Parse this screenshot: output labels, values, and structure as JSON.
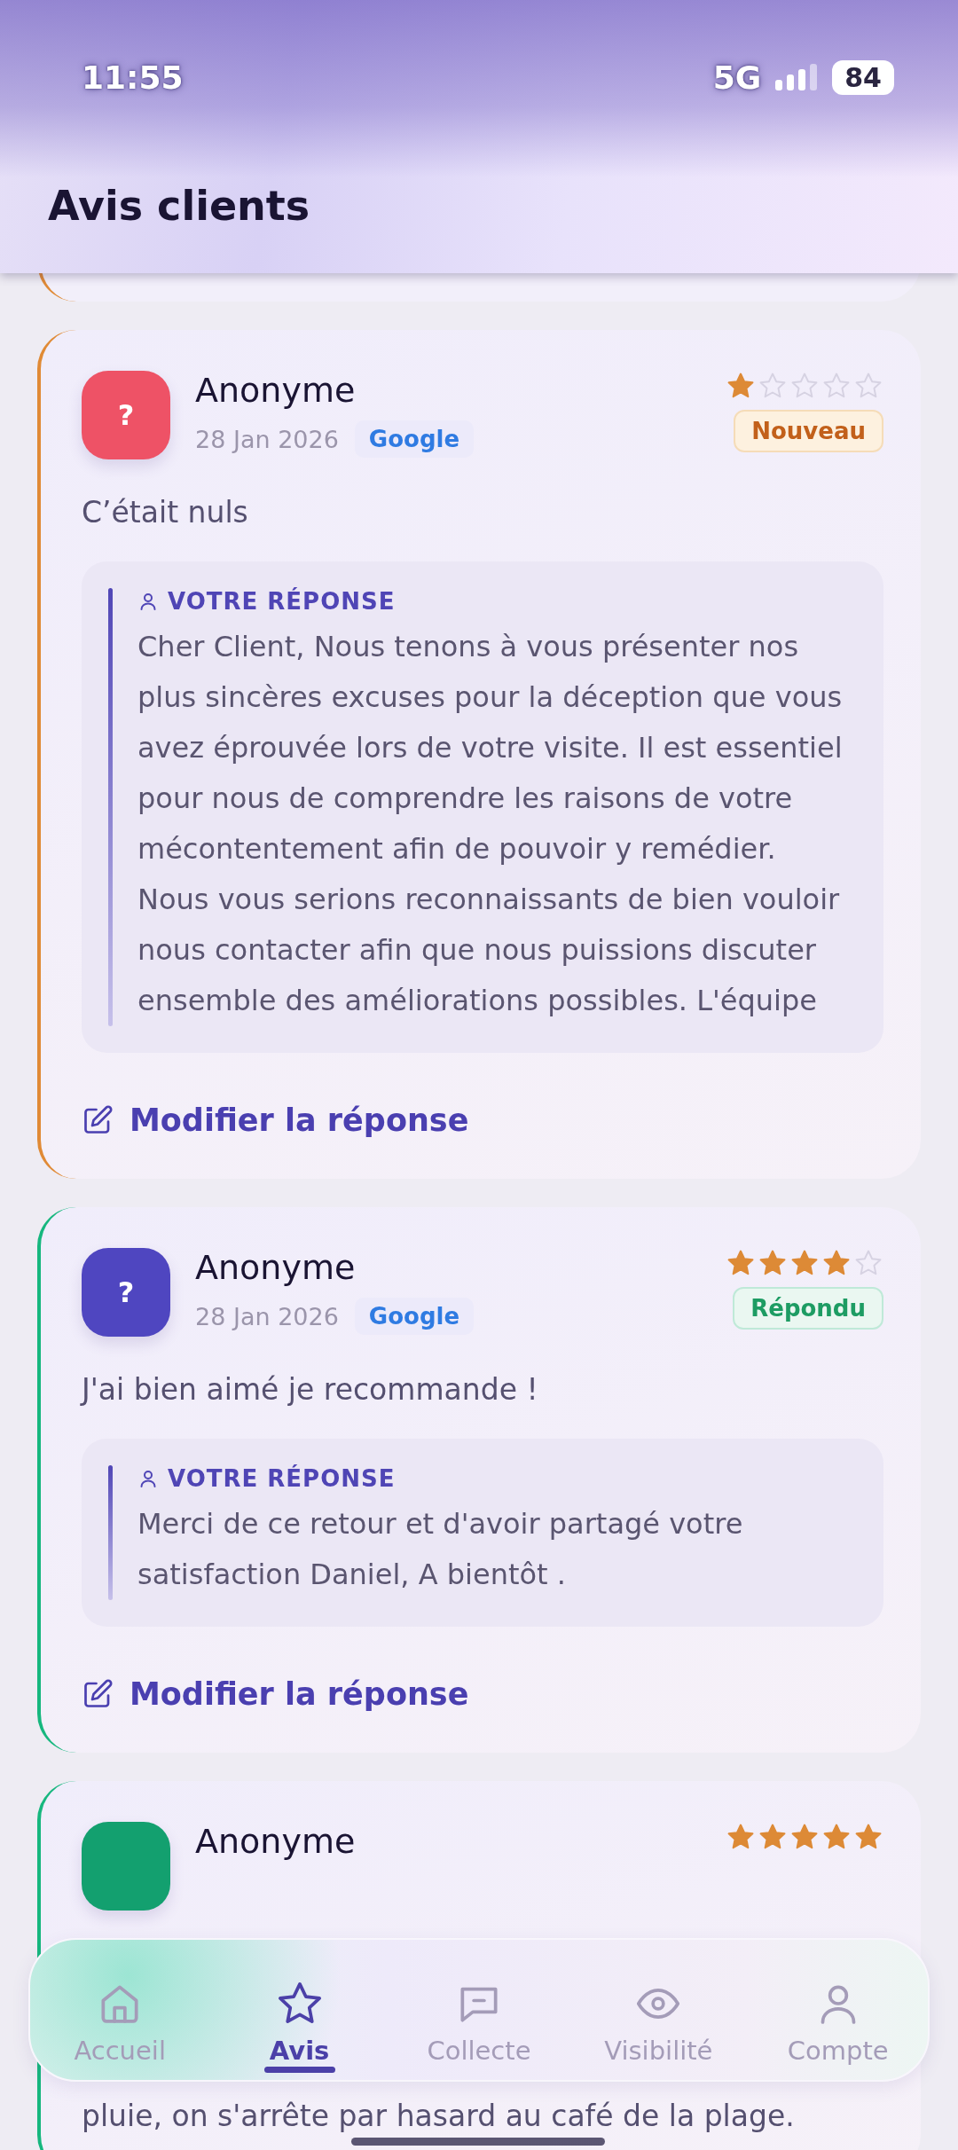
{
  "status_bar": {
    "time": "11:55",
    "network": "5G",
    "battery": "84"
  },
  "header": {
    "title": "Avis clients"
  },
  "clipped_card": {
    "kind": "new"
  },
  "reviews": [
    {
      "author": "Anonyme",
      "avatar": "?",
      "color": "#ee5266",
      "date": "28 Jan 2026",
      "source": "Google",
      "stars": 1,
      "kind": "new",
      "badge": "Nouveau",
      "text": "C’était nuls",
      "reply": {
        "label": "VOTRE RÉPONSE",
        "text": "Cher Client, Nous tenons à vous présenter nos plus sincères excuses pour la déception que vous avez éprouvée lors de votre visite. Il est essentiel pour nous de comprendre les raisons de votre mécontentement afin de pouvoir y remédier. Nous vous serions reconnaissants de bien vouloir nous contacter afin que nous puissions discuter ensemble des améliorations possibles. L'équipe"
      },
      "edit_link": "Modifier la réponse"
    },
    {
      "author": "Anonyme",
      "avatar": "?",
      "color": "#4f46c0",
      "date": "28 Jan 2026",
      "source": "Google",
      "stars": 4,
      "kind": "answered",
      "badge": "Répondu",
      "text": "J'ai bien aimé je recommande !",
      "reply": {
        "label": "VOTRE RÉPONSE",
        "text": "Merci de ce retour et d'avoir partagé votre satisfaction Daniel, A bientôt ."
      },
      "edit_link": "Modifier la réponse"
    },
    {
      "author": "Anonyme",
      "color": "#13a06f",
      "stars": 5,
      "kind": "answered",
      "text": "pluie, on s'arrête par hasard au café de la plage."
    }
  ],
  "nav": [
    {
      "label": "Accueil",
      "kind": "home",
      "selected": false
    },
    {
      "label": "Avis",
      "kind": "star",
      "selected": true
    },
    {
      "label": "Collecte",
      "kind": "message",
      "selected": false
    },
    {
      "label": "Visibilité",
      "kind": "eye",
      "selected": false
    },
    {
      "label": "Compte",
      "kind": "user",
      "selected": false
    }
  ]
}
